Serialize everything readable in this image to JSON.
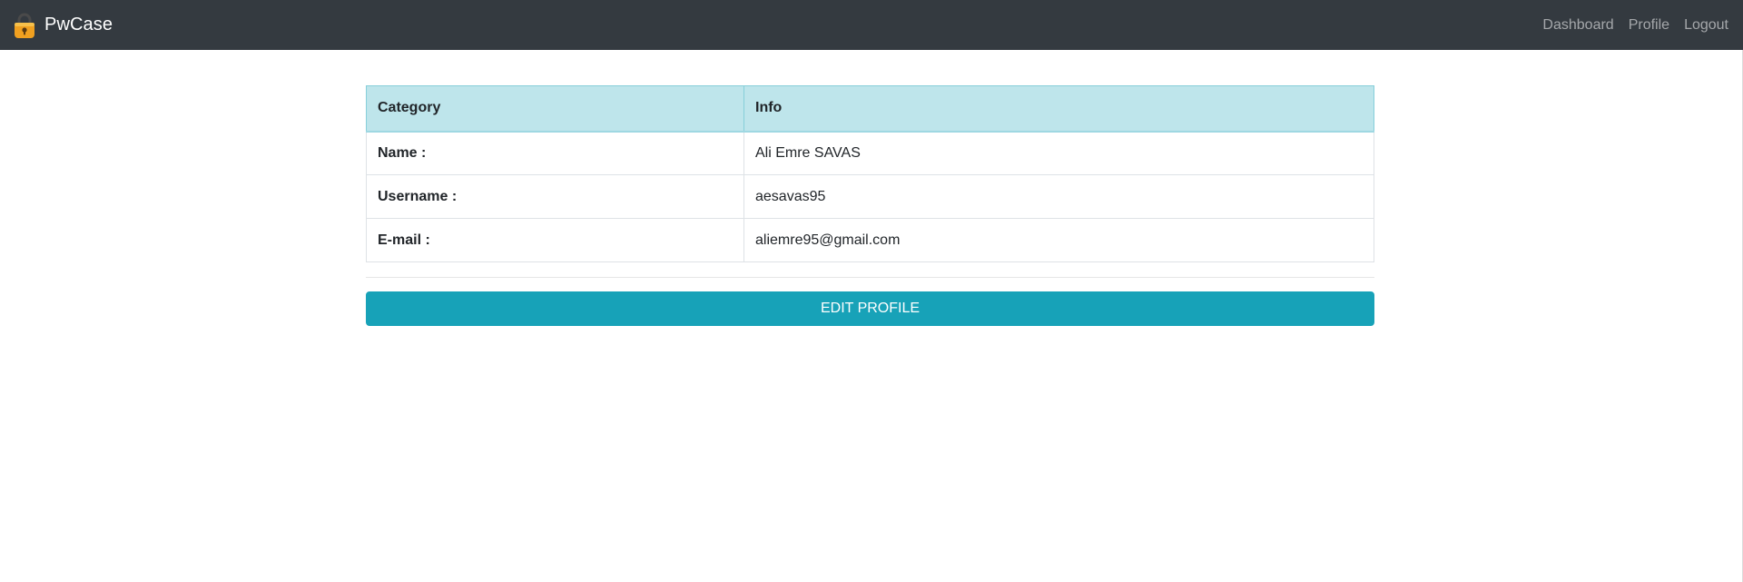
{
  "navbar": {
    "brand": "PwCase",
    "links": [
      {
        "label": "Dashboard"
      },
      {
        "label": "Profile"
      },
      {
        "label": "Logout"
      }
    ]
  },
  "table": {
    "headers": {
      "category": "Category",
      "info": "Info"
    },
    "rows": [
      {
        "category": "Name :",
        "info": "Ali Emre SAVAS"
      },
      {
        "category": "Username :",
        "info": "aesavas95"
      },
      {
        "category": "E-mail :",
        "info": "aliemre95@gmail.com"
      }
    ]
  },
  "actions": {
    "edit_profile": "EDIT PROFILE"
  },
  "colors": {
    "navbar": "#343a40",
    "header_row": "#bee5eb",
    "button": "#17a2b8",
    "lock_icon": "#f0a020"
  }
}
